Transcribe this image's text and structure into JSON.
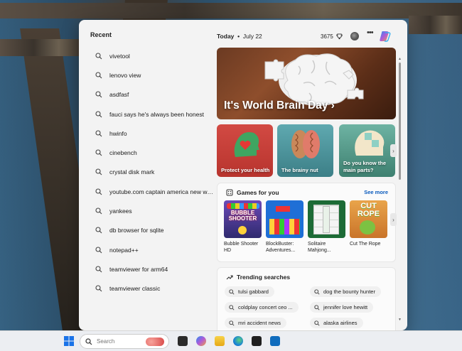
{
  "recent": {
    "title": "Recent",
    "items": [
      "vivetool",
      "lenovo view",
      "asdfasf",
      "fauci says he's always been honest",
      "hwinfo",
      "cinebench",
      "crystal disk mark",
      "youtube.com captain america new wo...",
      "yankees",
      "db browser for sqlite",
      "notepad++",
      "teamviewer for arm64",
      "teamviewer classic"
    ]
  },
  "header": {
    "today": "Today",
    "date": "July 22",
    "points": "3675"
  },
  "hero": {
    "title": "It's World Brain Day"
  },
  "cards": [
    {
      "label": "Protect your health"
    },
    {
      "label": "The brainy nut"
    },
    {
      "label": "Do you know the main parts?"
    }
  ],
  "games": {
    "title": "Games for you",
    "see_more": "See more",
    "items": [
      {
        "name": "Bubble Shooter HD",
        "thumb_text": "BUBBLE SHOOTER"
      },
      {
        "name": "BlockBuster: Adventures..."
      },
      {
        "name": "Solitaire Mahjong..."
      },
      {
        "name": "Cut The Rope",
        "thumb_text": "CUT ROPE"
      }
    ]
  },
  "trending": {
    "title": "Trending searches",
    "items": [
      "tulsi gabbard",
      "dog the bounty hunter",
      "coldplay concert ceo ...",
      "jennifer love hewitt",
      "mri accident news",
      "alaska airlines"
    ]
  },
  "taskbar": {
    "search_placeholder": "Search"
  },
  "colors": {
    "accent": "#0a5bbd",
    "panel": "#f3f3f3"
  }
}
